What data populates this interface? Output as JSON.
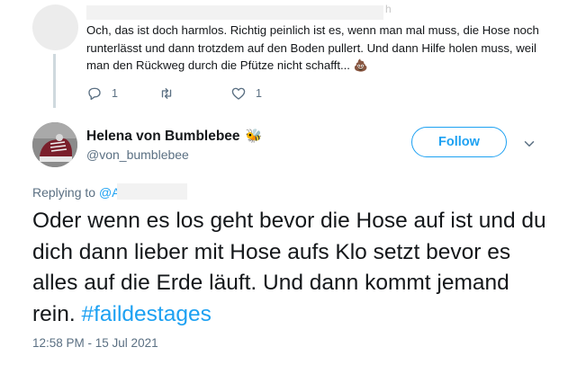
{
  "reply": {
    "text": "Och, das ist doch harmlos. Richtig peinlich ist es, wenn man mal muss, die Hose noch runterlässt und dann trotzdem auf den Boden pullert. Und dann Hilfe holen muss, weil man den Rückweg durch die Pfütze nicht schafft...",
    "emoji": "💩",
    "actions": {
      "reply_count": "1",
      "retweet_count": "",
      "like_count": "1"
    }
  },
  "tweet": {
    "display_name": "Helena von Bumblebee",
    "name_emoji": "🐝",
    "username": "@von_bumblebee",
    "follow_label": "Follow",
    "replying_prefix": "Replying to",
    "replying_mention": "@A",
    "text": "Oder wenn es los geht bevor die Hose auf ist und du dich dann lieber mit Hose aufs Klo setzt bevor es alles auf die Erde läuft. Und dann kommt jemand rein. ",
    "hashtag": "#faildestages",
    "timestamp": "12:58 PM - 15 Jul 2021"
  },
  "colors": {
    "accent": "#1da1f2",
    "muted": "#5b7083",
    "text": "#14171a"
  },
  "icons": [
    "reply-icon",
    "retweet-icon",
    "like-icon",
    "caret-down-icon",
    "bee-emoji",
    "poop-emoji"
  ]
}
